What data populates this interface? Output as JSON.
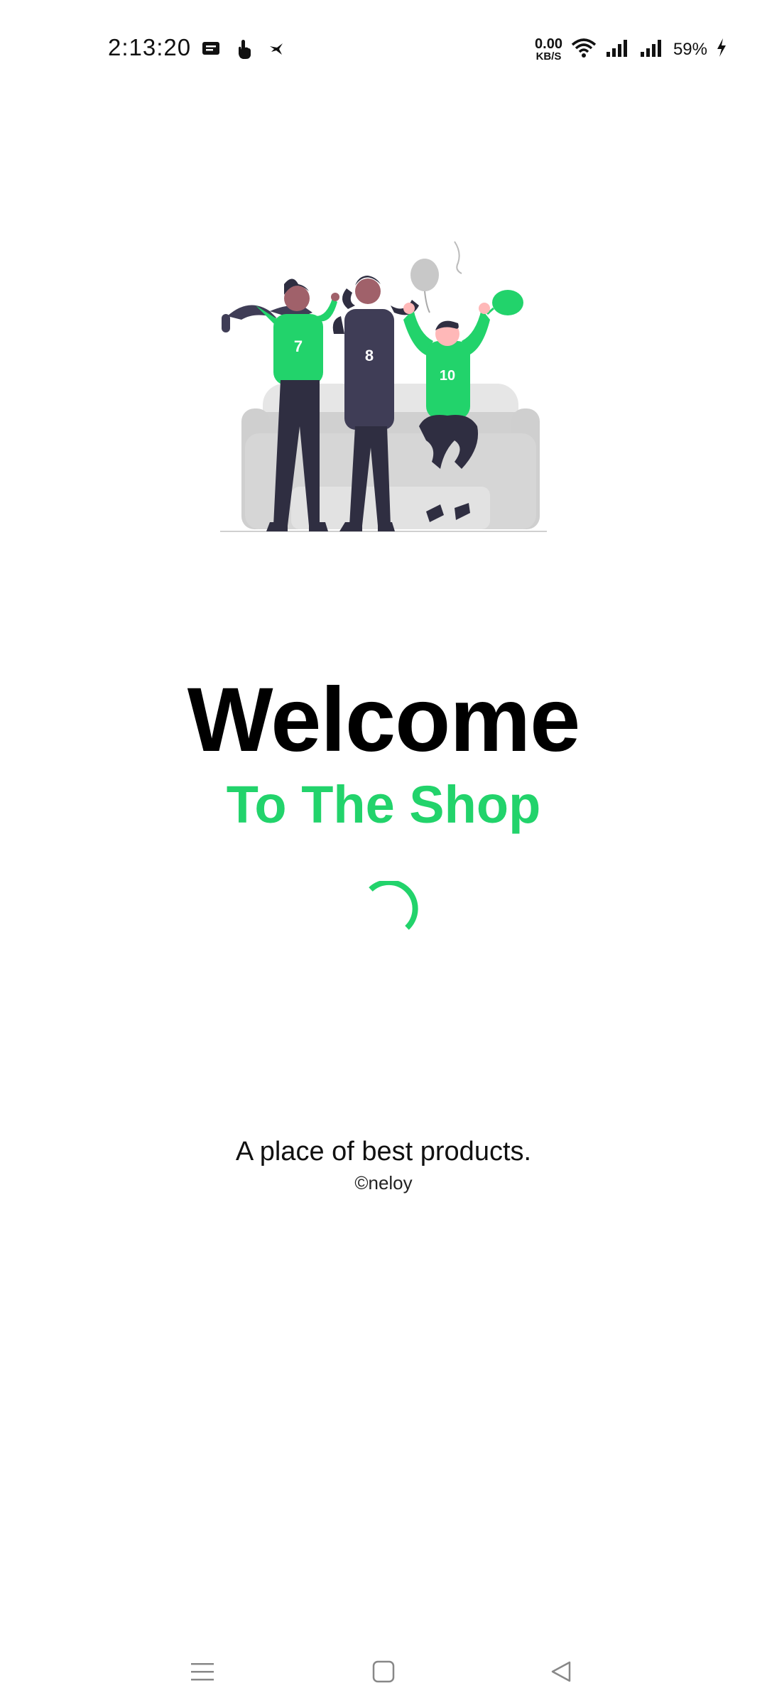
{
  "status_bar": {
    "time": "2:13:20",
    "net_speed_value": "0.00",
    "net_speed_unit": "KB/S",
    "battery": "59%"
  },
  "welcome": {
    "title": "Welcome",
    "subtitle": "To The Shop",
    "tagline": "A place of best products.",
    "copyright": "©neloy"
  },
  "illustration": {
    "jersey_numbers": [
      "7",
      "8",
      "10"
    ]
  },
  "colors": {
    "accent": "#22d36b",
    "text": "#000000"
  },
  "icons": {
    "notifications": [
      "message-icon",
      "touch-icon",
      "bird-icon"
    ],
    "system": [
      "wifi-icon",
      "signal-icon",
      "signal-icon",
      "charging-icon"
    ],
    "nav": [
      "menu-icon",
      "home-icon",
      "back-icon"
    ]
  }
}
